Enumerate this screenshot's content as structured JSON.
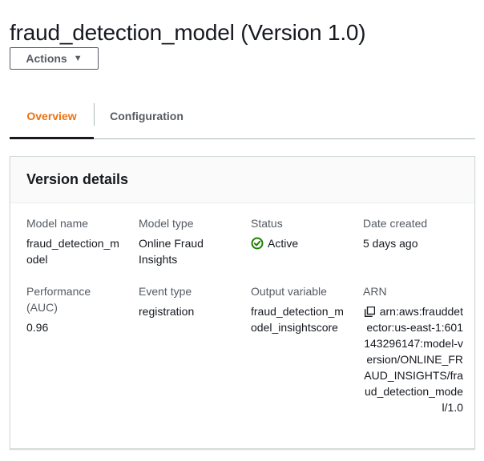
{
  "page": {
    "title": "fraud_detection_model (Version 1.0)"
  },
  "actions": {
    "label": "Actions",
    "caret_icon": "caret-down-icon"
  },
  "tabs": [
    {
      "label": "Overview",
      "active": true
    },
    {
      "label": "Configuration",
      "active": false
    }
  ],
  "panel": {
    "title": "Version details",
    "fields": {
      "model_name": {
        "label": "Model name",
        "value": "fraud_detection_model"
      },
      "model_type": {
        "label": "Model type",
        "value": "Online Fraud Insights"
      },
      "status": {
        "label": "Status",
        "value": "Active",
        "icon": "check-circle-icon",
        "color": "#1d8102"
      },
      "date_created": {
        "label": "Date created",
        "value": "5 days ago"
      },
      "performance": {
        "label": "Performance (AUC)",
        "value": "0.96"
      },
      "event_type": {
        "label": "Event type",
        "value": "registration",
        "color": "#0073bb"
      },
      "output_variable": {
        "label": "Output variable",
        "value": "fraud_detection_model_insightscore"
      },
      "arn": {
        "label": "ARN",
        "value": "arn:aws:frauddetector:us-east-1:601143296147:model-version/ONLINE_FRAUD_INSIGHTS/fraud_detection_model/1.0",
        "icon": "copy-icon"
      }
    }
  },
  "colors": {
    "accent": "#ec7211",
    "link": "#0073bb",
    "success": "#1d8102"
  }
}
